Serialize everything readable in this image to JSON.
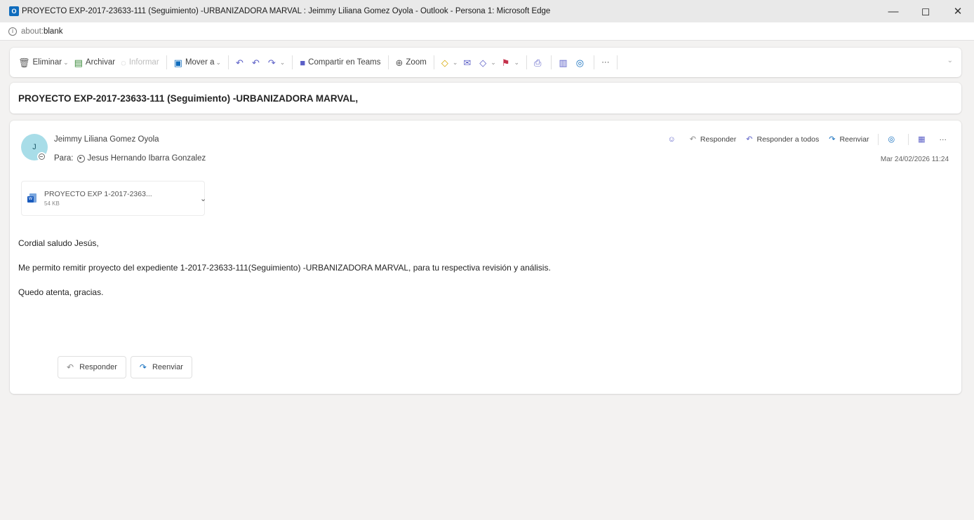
{
  "window": {
    "title": "PROYECTO EXP-2017-23633-111 (Seguimiento) -URBANIZADORA MARVAL : Jeimmy Liliana Gomez Oyola - Outlook - Persona 1: Microsoft Edge",
    "app_icon_letter": "O",
    "controls": {
      "minimize": "—",
      "restore": "◻",
      "close": "✕"
    }
  },
  "address_bar": {
    "scheme": "about:",
    "page": "blank"
  },
  "toolbar": {
    "delete_label": "Eliminar",
    "archive_label": "Archivar",
    "report_label": "Informar",
    "move_label": "Mover a",
    "teams_label": "Compartir en Teams",
    "zoom_label": "Zoom",
    "more_label": "···"
  },
  "subject": "PROYECTO EXP-2017-23633-111 (Seguimiento) -URBANIZADORA MARVAL,",
  "message": {
    "sender_initial": "J",
    "sender_name": "Jeimmy Liliana Gomez Oyola",
    "to_label": "Para:",
    "to_name": "Jesus Hernando Ibarra Gonzalez",
    "date": "Mar 24/02/2026 11:24",
    "actions": {
      "reply": "Responder",
      "reply_all": "Responder a todos",
      "forward": "Reenviar",
      "more": "···"
    },
    "attachment": {
      "name": "PROYECTO EXP 1-2017-2363...",
      "size": "54 KB"
    },
    "body": {
      "greeting": "Cordial saludo Jesús,",
      "paragraph": "Me permito remitir proyecto del expediente 1-2017-23633-111(Seguimiento) -URBANIZADORA MARVAL, para tu respectiva revisión y análisis.",
      "closing": "Quedo atenta, gracias."
    },
    "footer": {
      "reply": "Responder",
      "forward": "Reenviar"
    }
  }
}
